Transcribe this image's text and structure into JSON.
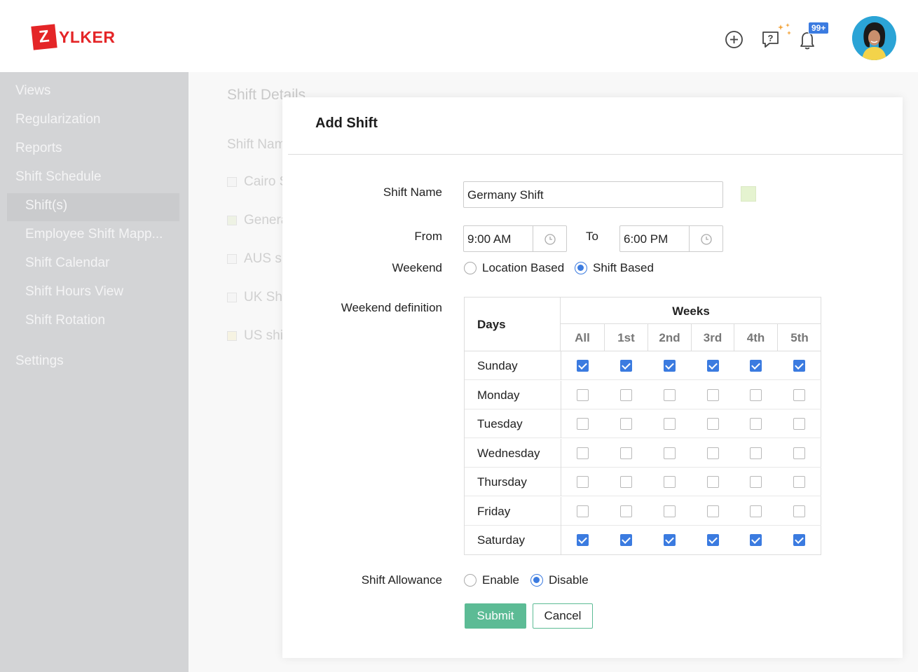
{
  "brand": {
    "logo_letter": "Z",
    "logo_text": "YLKER"
  },
  "header": {
    "notifications_badge": "99+"
  },
  "sidebar": {
    "items": [
      {
        "label": "Views"
      },
      {
        "label": "Regularization"
      },
      {
        "label": "Reports"
      },
      {
        "label": "Shift Schedule"
      },
      {
        "label": "Shift(s)"
      },
      {
        "label": "Employee Shift Mapp..."
      },
      {
        "label": "Shift Calendar"
      },
      {
        "label": "Shift Hours View"
      },
      {
        "label": "Shift Rotation"
      },
      {
        "label": "Settings"
      }
    ]
  },
  "background": {
    "title": "Shift Details",
    "column_label": "Shift Nam",
    "rows": [
      "Cairo S",
      "Genera",
      "AUS sh",
      "UK Shi",
      "US shif"
    ]
  },
  "modal": {
    "title": "Add Shift",
    "shift_name_label": "Shift Name",
    "shift_name_value": "Germany Shift",
    "swatch_color": "#e5f3d0",
    "from_label": "From",
    "from_value": "9:00 AM",
    "to_label": "To",
    "to_value": "6:00 PM",
    "weekend_label": "Weekend",
    "weekend_options": [
      "Location Based",
      "Shift Based"
    ],
    "weekend_selected": "Shift Based",
    "weekend_def_label": "Weekend definition",
    "table": {
      "days_header": "Days",
      "weeks_header": "Weeks",
      "columns": [
        "All",
        "1st",
        "2nd",
        "3rd",
        "4th",
        "5th"
      ],
      "rows": [
        {
          "day": "Sunday",
          "checked": [
            true,
            true,
            true,
            true,
            true,
            true
          ]
        },
        {
          "day": "Monday",
          "checked": [
            false,
            false,
            false,
            false,
            false,
            false
          ]
        },
        {
          "day": "Tuesday",
          "checked": [
            false,
            false,
            false,
            false,
            false,
            false
          ]
        },
        {
          "day": "Wednesday",
          "checked": [
            false,
            false,
            false,
            false,
            false,
            false
          ]
        },
        {
          "day": "Thursday",
          "checked": [
            false,
            false,
            false,
            false,
            false,
            false
          ]
        },
        {
          "day": "Friday",
          "checked": [
            false,
            false,
            false,
            false,
            false,
            false
          ]
        },
        {
          "day": "Saturday",
          "checked": [
            true,
            true,
            true,
            true,
            true,
            true
          ]
        }
      ]
    },
    "allowance_label": "Shift Allowance",
    "allowance_options": [
      "Enable",
      "Disable"
    ],
    "allowance_selected": "Disable",
    "submit_label": "Submit",
    "cancel_label": "Cancel"
  }
}
